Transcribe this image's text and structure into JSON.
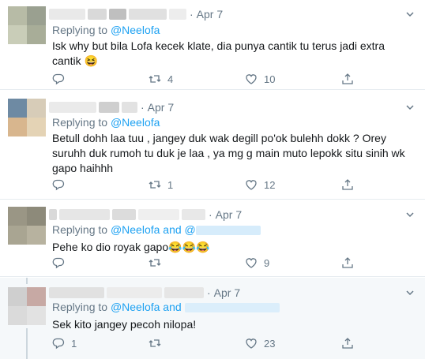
{
  "tweets": [
    {
      "date": "Apr 7",
      "dot": "·",
      "reply_prefix": "Replying to",
      "reply_mention": "@Neelofa",
      "reply_extra": "",
      "text": "Isk why but bila Lofa kecek klate, dia punya cantik tu terus jadi extra cantik 😆",
      "reply_count": "",
      "retweet_count": "4",
      "like_count": "10"
    },
    {
      "date": "Apr 7",
      "dot": "·",
      "reply_prefix": "Replying to",
      "reply_mention": "@Neelofa",
      "reply_extra": "",
      "text": "Betull dohh laa tuu , jangey duk wak degill po'ok bulehh dokk ? Orey suruhh duk rumoh tu duk je laa , ya mg g main muto lepokk situ sinih wk gapo haihhh",
      "reply_count": "",
      "retweet_count": "1",
      "like_count": "12"
    },
    {
      "date": "Apr 7",
      "dot": "·",
      "reply_prefix": "Replying to",
      "reply_mention": "@Neelofa and",
      "reply_extra": "@",
      "text": "Pehe ko dio royak gapo😂😂😂",
      "reply_count": "",
      "retweet_count": "",
      "like_count": "9"
    },
    {
      "date": "Apr 7",
      "dot": "·",
      "reply_prefix": "Replying to",
      "reply_mention": "@Neelofa and",
      "reply_extra": "",
      "text": "Sek kito jangey pecoh nilopa!",
      "reply_count": "1",
      "retweet_count": "",
      "like_count": "23"
    }
  ],
  "icons": {
    "reply": "reply-icon",
    "retweet": "retweet-icon",
    "like": "heart-icon",
    "share": "share-icon",
    "menu": "chevron-down-icon"
  },
  "colors": {
    "link": "#1da1f2",
    "muted": "#657786",
    "text": "#14171a",
    "divider": "#e6ecf0",
    "highlight_bg": "#f5f8fa"
  }
}
